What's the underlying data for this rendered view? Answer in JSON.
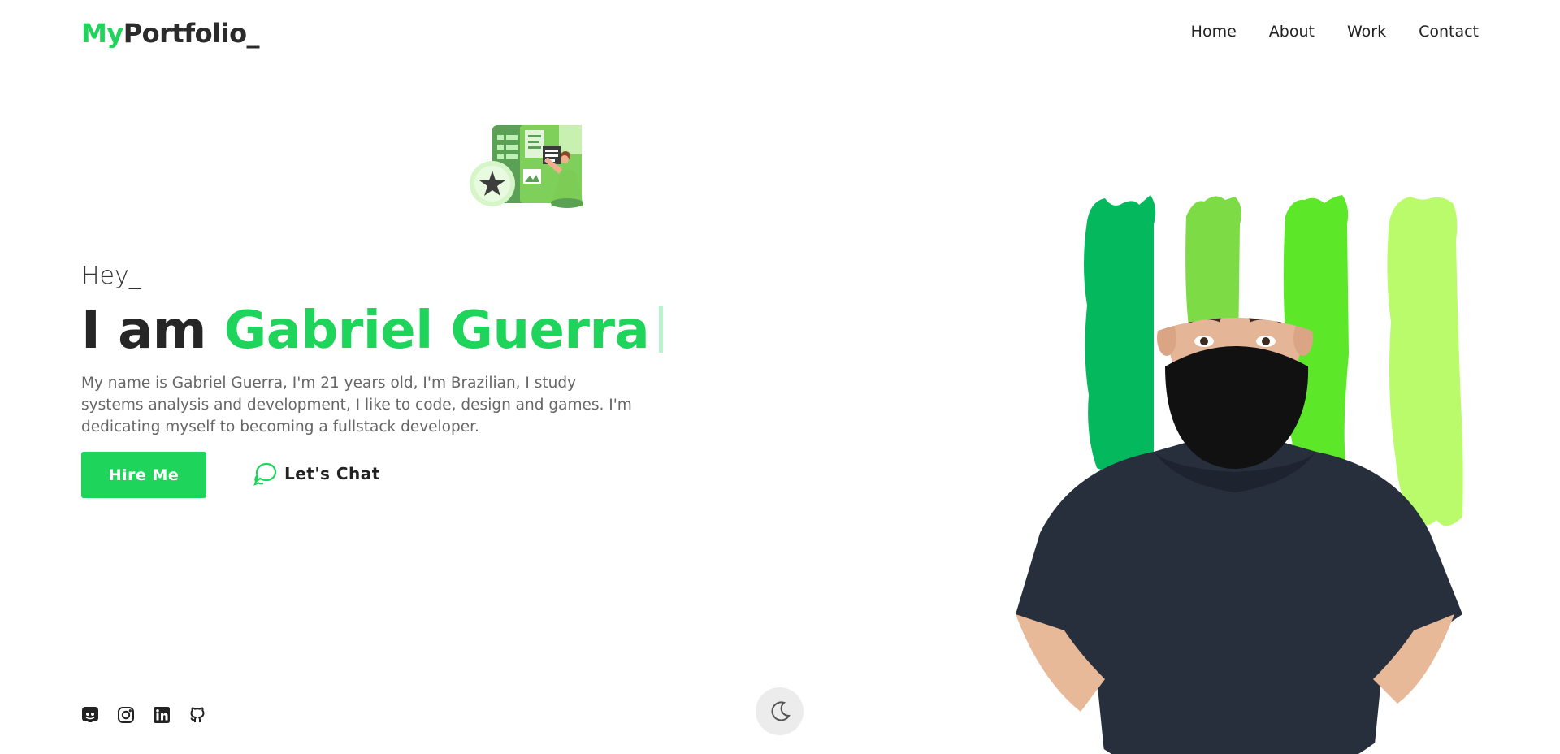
{
  "header": {
    "logo_accent": "My",
    "logo_rest": "Portfolio_",
    "nav": [
      {
        "label": "Home"
      },
      {
        "label": "About"
      },
      {
        "label": "Work"
      },
      {
        "label": "Contact"
      }
    ]
  },
  "hero": {
    "greeting": "Hey_",
    "headline_prefix": "I am",
    "headline_name": "Gabriel Guerra",
    "description": "My name is Gabriel Guerra, I'm 21 years old, I'm Brazilian, I study systems analysis and development, I like to code, design and games. I'm dedicating myself to becoming a fullstack developer.",
    "hire_label": "Hire Me",
    "chat_label": "Let's Chat"
  },
  "socials": [
    {
      "icon": "discord-icon"
    },
    {
      "icon": "instagram-icon"
    },
    {
      "icon": "linkedin-icon"
    },
    {
      "icon": "github-icon"
    }
  ],
  "theme_toggle": {
    "icon": "moon-icon"
  },
  "colors": {
    "accent": "#1ed45a",
    "stroke_dark": "#04b85d",
    "stroke_mid": "#7ddc45",
    "stroke_bright": "#5ce828",
    "stroke_light": "#b9fb6a",
    "text_dark": "#262626",
    "text_muted": "#666666"
  }
}
